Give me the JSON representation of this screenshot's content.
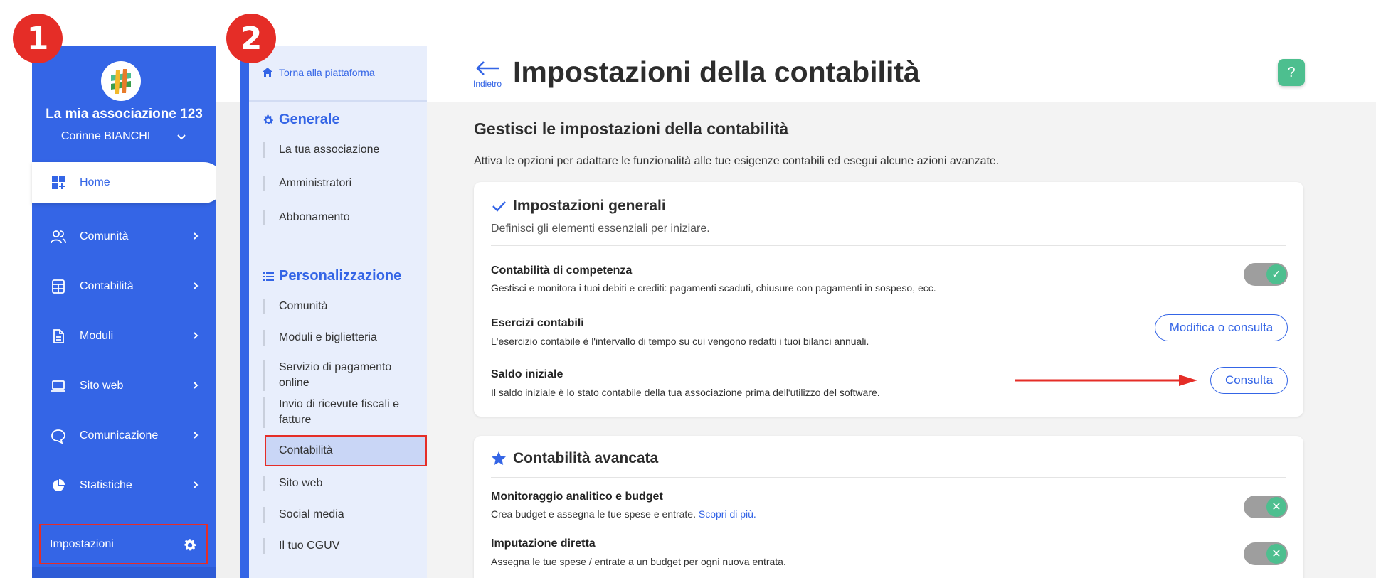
{
  "badges": {
    "step1": "1",
    "step2": "2"
  },
  "sidebar": {
    "association_name": "La mia associazione 123",
    "user_name": "Corinne BIANCHI",
    "items": [
      {
        "label": "Home",
        "icon": "dashboard-icon"
      },
      {
        "label": "Comunità",
        "icon": "users-icon"
      },
      {
        "label": "Contabilità",
        "icon": "calculator-icon"
      },
      {
        "label": "Moduli",
        "icon": "document-icon"
      },
      {
        "label": "Sito web",
        "icon": "laptop-icon"
      },
      {
        "label": "Comunicazione",
        "icon": "chat-icon"
      },
      {
        "label": "Statistiche",
        "icon": "pie-chart-icon"
      }
    ],
    "settings_label": "Impostazioni"
  },
  "subsidebar": {
    "back_label": "Torna alla piattaforma",
    "section_general": "Generale",
    "general_items": [
      "La tua associazione",
      "Amministratori",
      "Abbonamento"
    ],
    "section_custom": "Personalizzazione",
    "custom_items": [
      "Comunità",
      "Moduli e biglietteria",
      "Servizio di pagamento online",
      "Invio di ricevute fiscali e fatture",
      "Contabilità",
      "Sito web",
      "Social media",
      "Il tuo CGUV"
    ]
  },
  "header": {
    "back_label": "Indietro",
    "title": "Impostazioni della contabilità",
    "help_label": "?"
  },
  "main": {
    "heading": "Gestisci le impostazioni della contabilità",
    "intro": "Attiva le opzioni per adattare le funzionalità alle tue esigenze contabili ed esegui alcune azioni avanzate.",
    "general_card": {
      "title": "Impostazioni generali",
      "subtitle": "Definisci gli elementi essenziali per iniziare.",
      "rows": [
        {
          "title": "Contabilità di competenza",
          "desc": "Gestisci e monitora i tuoi debiti e crediti: pagamenti scaduti, chiusure con pagamenti in sospeso, ecc.",
          "toggle_glyph": "✓"
        },
        {
          "title": "Esercizi contabili",
          "desc": "L'esercizio contabile è l'intervallo di tempo su cui vengono redatti i tuoi bilanci annuali.",
          "button": "Modifica o consulta"
        },
        {
          "title": "Saldo iniziale",
          "desc": "Il saldo iniziale è lo stato contabile della tua associazione prima dell'utilizzo del software.",
          "button": "Consulta"
        }
      ]
    },
    "advanced_card": {
      "title": "Contabilità avancata",
      "rows": [
        {
          "title": "Monitoraggio analitico e budget",
          "desc": "Crea budget e assegna le tue spese e entrate.",
          "link": "Scopri di più.",
          "toggle_glyph": "✕"
        },
        {
          "title": "Imputazione diretta",
          "desc": "Assegna le tue spese / entrate a un budget per ogni nuova entrata.",
          "toggle_glyph": "✕"
        }
      ]
    }
  },
  "colors": {
    "brand_blue": "#3465e6",
    "highlight_red": "#e52d27",
    "success_green": "#4dbf8f"
  }
}
